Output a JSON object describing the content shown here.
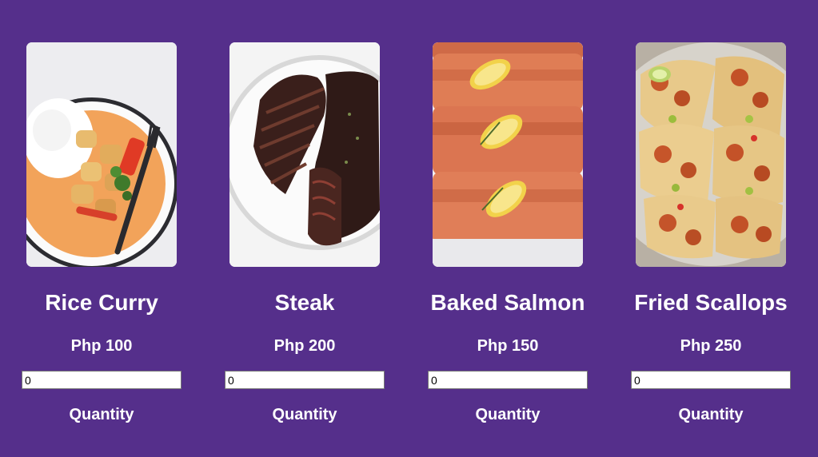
{
  "colors": {
    "background": "#552f8b",
    "text": "#ffffff"
  },
  "items": [
    {
      "name": "Rice Curry",
      "price": "Php 100",
      "quantity_value": "0",
      "quantity_label": "Quantity",
      "image": "rice-curry-photo"
    },
    {
      "name": "Steak",
      "price": "Php 200",
      "quantity_value": "0",
      "quantity_label": "Quantity",
      "image": "steak-photo"
    },
    {
      "name": "Baked Salmon",
      "price": "Php 150",
      "quantity_value": "0",
      "quantity_label": "Quantity",
      "image": "baked-salmon-photo"
    },
    {
      "name": "Fried Scallops",
      "price": "Php 250",
      "quantity_value": "0",
      "quantity_label": "Quantity",
      "image": "fried-scallops-photo"
    }
  ]
}
